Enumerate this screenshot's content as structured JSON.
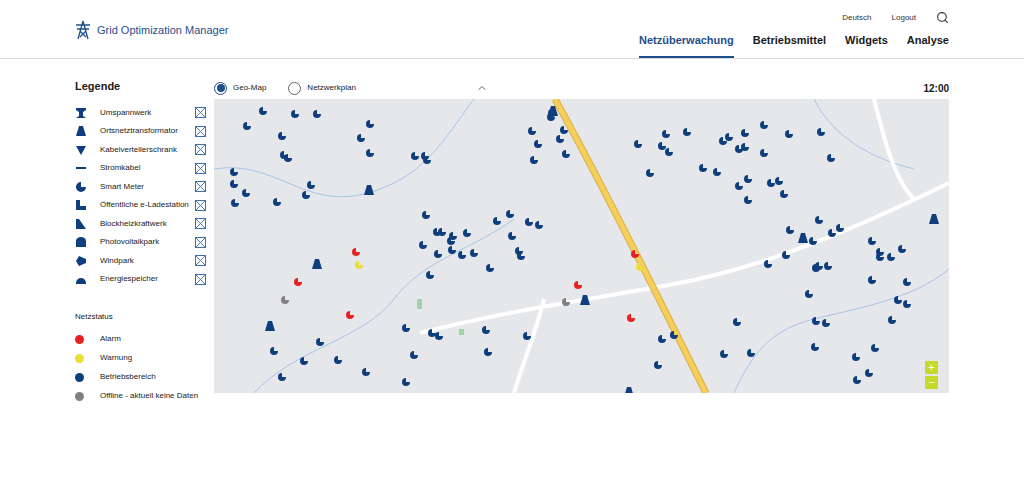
{
  "app": {
    "title": "Grid Optimization Manager"
  },
  "header_links": [
    "Deutsch",
    "Logout"
  ],
  "nav": [
    {
      "label": "Netzüberwachung",
      "selected": true
    },
    {
      "label": "Betriebsmittel",
      "selected": false
    },
    {
      "label": "Widgets",
      "selected": false
    },
    {
      "label": "Analyse",
      "selected": false
    }
  ],
  "legend": {
    "title": "Legende",
    "items": [
      {
        "label": "Umspannwerk",
        "kind": "substation",
        "checked": true
      },
      {
        "label": "Ortsnetztransformator",
        "kind": "transformer",
        "checked": true
      },
      {
        "label": "Kabelverteilerschrank",
        "kind": "cabinet",
        "checked": true
      },
      {
        "label": "Stromkabel",
        "kind": "cable",
        "checked": true
      },
      {
        "label": "Smart Meter",
        "kind": "smart-meter",
        "checked": true
      },
      {
        "label": "Öffentliche e-Ladestation",
        "kind": "charging",
        "checked": true
      },
      {
        "label": "Blockheizkraftwerk",
        "kind": "chp",
        "checked": true
      },
      {
        "label": "Photovoltaikpark",
        "kind": "pv",
        "checked": true
      },
      {
        "label": "Windpark",
        "kind": "wind",
        "checked": true
      },
      {
        "label": "Energiespeicher",
        "kind": "storage",
        "checked": true
      }
    ]
  },
  "status": {
    "title": "Netzstatus",
    "items": [
      {
        "label": "Alarm",
        "color": "#e8201f"
      },
      {
        "label": "Warnung",
        "color": "#ebdd3a"
      },
      {
        "label": "Betriebsbereich",
        "color": "#0e3e7e"
      },
      {
        "label": "Offline - aktuell keine Daten",
        "color": "#808080"
      }
    ]
  },
  "views": [
    {
      "label": "Geo-Map",
      "selected": true
    },
    {
      "label": "Netzwerkplan",
      "selected": false
    }
  ],
  "time": "12:00",
  "zoom": [
    "+",
    "−"
  ],
  "markers": [
    {
      "kind": "smart-meter",
      "status": "Alarm"
    },
    {
      "kind": "smart-meter",
      "status": "Alarm"
    },
    {
      "kind": "smart-meter",
      "status": "Alarm"
    },
    {
      "kind": "smart-meter",
      "status": "Alarm"
    },
    {
      "kind": "smart-meter",
      "status": "Alarm"
    },
    {
      "kind": "smart-meter",
      "status": "Alarm"
    },
    {
      "kind": "smart-meter",
      "status": "Warnung"
    },
    {
      "kind": "smart-meter",
      "status": "Warnung"
    },
    {
      "kind": "smart-meter",
      "status": "Offline - aktuell keine Daten"
    },
    {
      "kind": "smart-meter",
      "status": "Offline - aktuell keine Daten"
    },
    {
      "kind": "transformer",
      "status": "Betriebsbereich"
    },
    {
      "kind": "transformer",
      "status": "Betriebsbereich"
    },
    {
      "kind": "transformer",
      "status": "Betriebsbereich"
    },
    {
      "kind": "transformer",
      "status": "Betriebsbereich"
    },
    {
      "kind": "transformer",
      "status": "Betriebsbereich"
    },
    {
      "kind": "transformer",
      "status": "Betriebsbereich"
    },
    {
      "kind": "transformer",
      "status": "Betriebsbereich"
    },
    {
      "kind": "transformer",
      "status": "Betriebsbereich"
    },
    {
      "kind": "smart-meter",
      "status": "Betriebsbereich"
    },
    {
      "kind": "smart-meter",
      "status": "Betriebsbereich"
    },
    {
      "kind": "smart-meter",
      "status": "Betriebsbereich"
    },
    {
      "kind": "smart-meter",
      "status": "Betriebsbereich"
    },
    {
      "kind": "smart-meter",
      "status": "Betriebsbereich"
    },
    {
      "kind": "smart-meter",
      "status": "Betriebsbereich"
    },
    {
      "kind": "smart-meter",
      "status": "Betriebsbereich"
    },
    {
      "kind": "smart-meter",
      "status": "Betriebsbereich"
    },
    {
      "kind": "smart-meter",
      "status": "Betriebsbereich"
    },
    {
      "kind": "smart-meter",
      "status": "Betriebsbereich"
    },
    {
      "kind": "smart-meter",
      "status": "Betriebsbereich"
    },
    {
      "kind": "smart-meter",
      "status": "Betriebsbereich"
    },
    {
      "kind": "smart-meter",
      "status": "Betriebsbereich"
    },
    {
      "kind": "smart-meter",
      "status": "Betriebsbereich"
    },
    {
      "kind": "smart-meter",
      "status": "Betriebsbereich"
    },
    {
      "kind": "smart-meter",
      "status": "Betriebsbereich"
    },
    {
      "kind": "smart-meter",
      "status": "Betriebsbereich"
    },
    {
      "kind": "smart-meter",
      "status": "Betriebsbereich"
    },
    {
      "kind": "smart-meter",
      "status": "Betriebsbereich"
    },
    {
      "kind": "smart-meter",
      "status": "Betriebsbereich"
    },
    {
      "kind": "smart-meter",
      "status": "Betriebsbereich"
    },
    {
      "kind": "smart-meter",
      "status": "Betriebsbereich"
    },
    {
      "kind": "smart-meter",
      "status": "Betriebsbereich"
    },
    {
      "kind": "smart-meter",
      "status": "Betriebsbereich"
    },
    {
      "kind": "smart-meter",
      "status": "Betriebsbereich"
    },
    {
      "kind": "smart-meter",
      "status": "Betriebsbereich"
    },
    {
      "kind": "smart-meter",
      "status": "Betriebsbereich"
    },
    {
      "kind": "smart-meter",
      "status": "Betriebsbereich"
    },
    {
      "kind": "smart-meter",
      "status": "Betriebsbereich"
    },
    {
      "kind": "smart-meter",
      "status": "Betriebsbereich"
    },
    {
      "kind": "smart-meter",
      "status": "Betriebsbereich"
    },
    {
      "kind": "smart-meter",
      "status": "Betriebsbereich"
    },
    {
      "kind": "smart-meter",
      "status": "Betriebsbereich"
    },
    {
      "kind": "smart-meter",
      "status": "Betriebsbereich"
    },
    {
      "kind": "smart-meter",
      "status": "Betriebsbereich"
    },
    {
      "kind": "smart-meter",
      "status": "Betriebsbereich"
    },
    {
      "kind": "smart-meter",
      "status": "Betriebsbereich"
    },
    {
      "kind": "smart-meter",
      "status": "Betriebsbereich"
    },
    {
      "kind": "smart-meter",
      "status": "Betriebsbereich"
    },
    {
      "kind": "smart-meter",
      "status": "Betriebsbereich"
    },
    {
      "kind": "smart-meter",
      "status": "Betriebsbereich"
    },
    {
      "kind": "smart-meter",
      "status": "Betriebsbereich"
    },
    {
      "kind": "smart-meter",
      "status": "Betriebsbereich"
    },
    {
      "kind": "smart-meter",
      "status": "Betriebsbereich"
    },
    {
      "kind": "smart-meter",
      "status": "Betriebsbereich"
    },
    {
      "kind": "smart-meter",
      "status": "Betriebsbereich"
    },
    {
      "kind": "smart-meter",
      "status": "Betriebsbereich"
    },
    {
      "kind": "smart-meter",
      "status": "Betriebsbereich"
    },
    {
      "kind": "smart-meter",
      "status": "Betriebsbereich"
    },
    {
      "kind": "smart-meter",
      "status": "Betriebsbereich"
    },
    {
      "kind": "smart-meter",
      "status": "Betriebsbereich"
    },
    {
      "kind": "smart-meter",
      "status": "Betriebsbereich"
    },
    {
      "kind": "smart-meter",
      "status": "Betriebsbereich"
    },
    {
      "kind": "smart-meter",
      "status": "Betriebsbereich"
    },
    {
      "kind": "smart-meter",
      "status": "Betriebsbereich"
    },
    {
      "kind": "smart-meter",
      "status": "Betriebsbereich"
    },
    {
      "kind": "smart-meter",
      "status": "Betriebsbereich"
    },
    {
      "kind": "smart-meter",
      "status": "Betriebsbereich"
    },
    {
      "kind": "smart-meter",
      "status": "Betriebsbereich"
    },
    {
      "kind": "smart-meter",
      "status": "Betriebsbereich"
    },
    {
      "kind": "smart-meter",
      "status": "Betriebsbereich"
    },
    {
      "kind": "smart-meter",
      "status": "Betriebsbereich"
    },
    {
      "kind": "smart-meter",
      "status": "Betriebsbereich"
    },
    {
      "kind": "smart-meter",
      "status": "Betriebsbereich"
    },
    {
      "kind": "smart-meter",
      "status": "Betriebsbereich"
    },
    {
      "kind": "smart-meter",
      "status": "Betriebsbereich"
    },
    {
      "kind": "smart-meter",
      "status": "Betriebsbereich"
    },
    {
      "kind": "smart-meter",
      "status": "Betriebsbereich"
    },
    {
      "kind": "smart-meter",
      "status": "Betriebsbereich"
    },
    {
      "kind": "smart-meter",
      "status": "Betriebsbereich"
    },
    {
      "kind": "smart-meter",
      "status": "Betriebsbereich"
    },
    {
      "kind": "smart-meter",
      "status": "Betriebsbereich"
    },
    {
      "kind": "smart-meter",
      "status": "Betriebsbereich"
    },
    {
      "kind": "smart-meter",
      "status": "Betriebsbereich"
    },
    {
      "kind": "smart-meter",
      "status": "Betriebsbereich"
    },
    {
      "kind": "smart-meter",
      "status": "Betriebsbereich"
    },
    {
      "kind": "smart-meter",
      "status": "Betriebsbereich"
    },
    {
      "kind": "smart-meter",
      "status": "Betriebsbereich"
    },
    {
      "kind": "smart-meter",
      "status": "Betriebsbereich"
    },
    {
      "kind": "smart-meter",
      "status": "Betriebsbereich"
    },
    {
      "kind": "smart-meter",
      "status": "Betriebsbereich"
    },
    {
      "kind": "smart-meter",
      "status": "Betriebsbereich"
    },
    {
      "kind": "smart-meter",
      "status": "Betriebsbereich"
    },
    {
      "kind": "smart-meter",
      "status": "Betriebsbereich"
    },
    {
      "kind": "smart-meter",
      "status": "Betriebsbereich"
    },
    {
      "kind": "smart-meter",
      "status": "Betriebsbereich"
    },
    {
      "kind": "smart-meter",
      "status": "Betriebsbereich"
    },
    {
      "kind": "smart-meter",
      "status": "Betriebsbereich"
    },
    {
      "kind": "smart-meter",
      "status": "Betriebsbereich"
    },
    {
      "kind": "smart-meter",
      "status": "Betriebsbereich"
    },
    {
      "kind": "smart-meter",
      "status": "Betriebsbereich"
    },
    {
      "kind": "smart-meter",
      "status": "Betriebsbereich"
    },
    {
      "kind": "smart-meter",
      "status": "Betriebsbereich"
    },
    {
      "kind": "smart-meter",
      "status": "Betriebsbereich"
    },
    {
      "kind": "smart-meter",
      "status": "Betriebsbereich"
    },
    {
      "kind": "smart-meter",
      "status": "Betriebsbereich"
    },
    {
      "kind": "smart-meter",
      "status": "Betriebsbereich"
    },
    {
      "kind": "smart-meter",
      "status": "Betriebsbereich"
    },
    {
      "kind": "smart-meter",
      "status": "Betriebsbereich"
    },
    {
      "kind": "smart-meter",
      "status": "Betriebsbereich"
    },
    {
      "kind": "smart-meter",
      "status": "Betriebsbereich"
    },
    {
      "kind": "smart-meter",
      "status": "Betriebsbereich"
    },
    {
      "kind": "smart-meter",
      "status": "Betriebsbereich"
    },
    {
      "kind": "smart-meter",
      "status": "Betriebsbereich"
    },
    {
      "kind": "smart-meter",
      "status": "Betriebsbereich"
    },
    {
      "kind": "smart-meter",
      "status": "Betriebsbereich"
    },
    {
      "kind": "smart-meter",
      "status": "Betriebsbereich"
    },
    {
      "kind": "smart-meter",
      "status": "Betriebsbereich"
    },
    {
      "kind": "smart-meter",
      "status": "Betriebsbereich"
    },
    {
      "kind": "smart-meter",
      "status": "Betriebsbereich"
    },
    {
      "kind": "smart-meter",
      "status": "Betriebsbereich"
    },
    {
      "kind": "smart-meter",
      "status": "Betriebsbereich"
    },
    {
      "kind": "smart-meter",
      "status": "Betriebsbereich"
    },
    {
      "kind": "smart-meter",
      "status": "Betriebsbereich"
    },
    {
      "kind": "smart-meter",
      "status": "Betriebsbereich"
    },
    {
      "kind": "smart-meter",
      "status": "Betriebsbereich"
    },
    {
      "kind": "smart-meter",
      "status": "Betriebsbereich"
    },
    {
      "kind": "smart-meter",
      "status": "Betriebsbereich"
    },
    {
      "kind": "smart-meter",
      "status": "Betriebsbereich"
    },
    {
      "kind": "smart-meter",
      "status": "Betriebsbereich"
    }
  ]
}
